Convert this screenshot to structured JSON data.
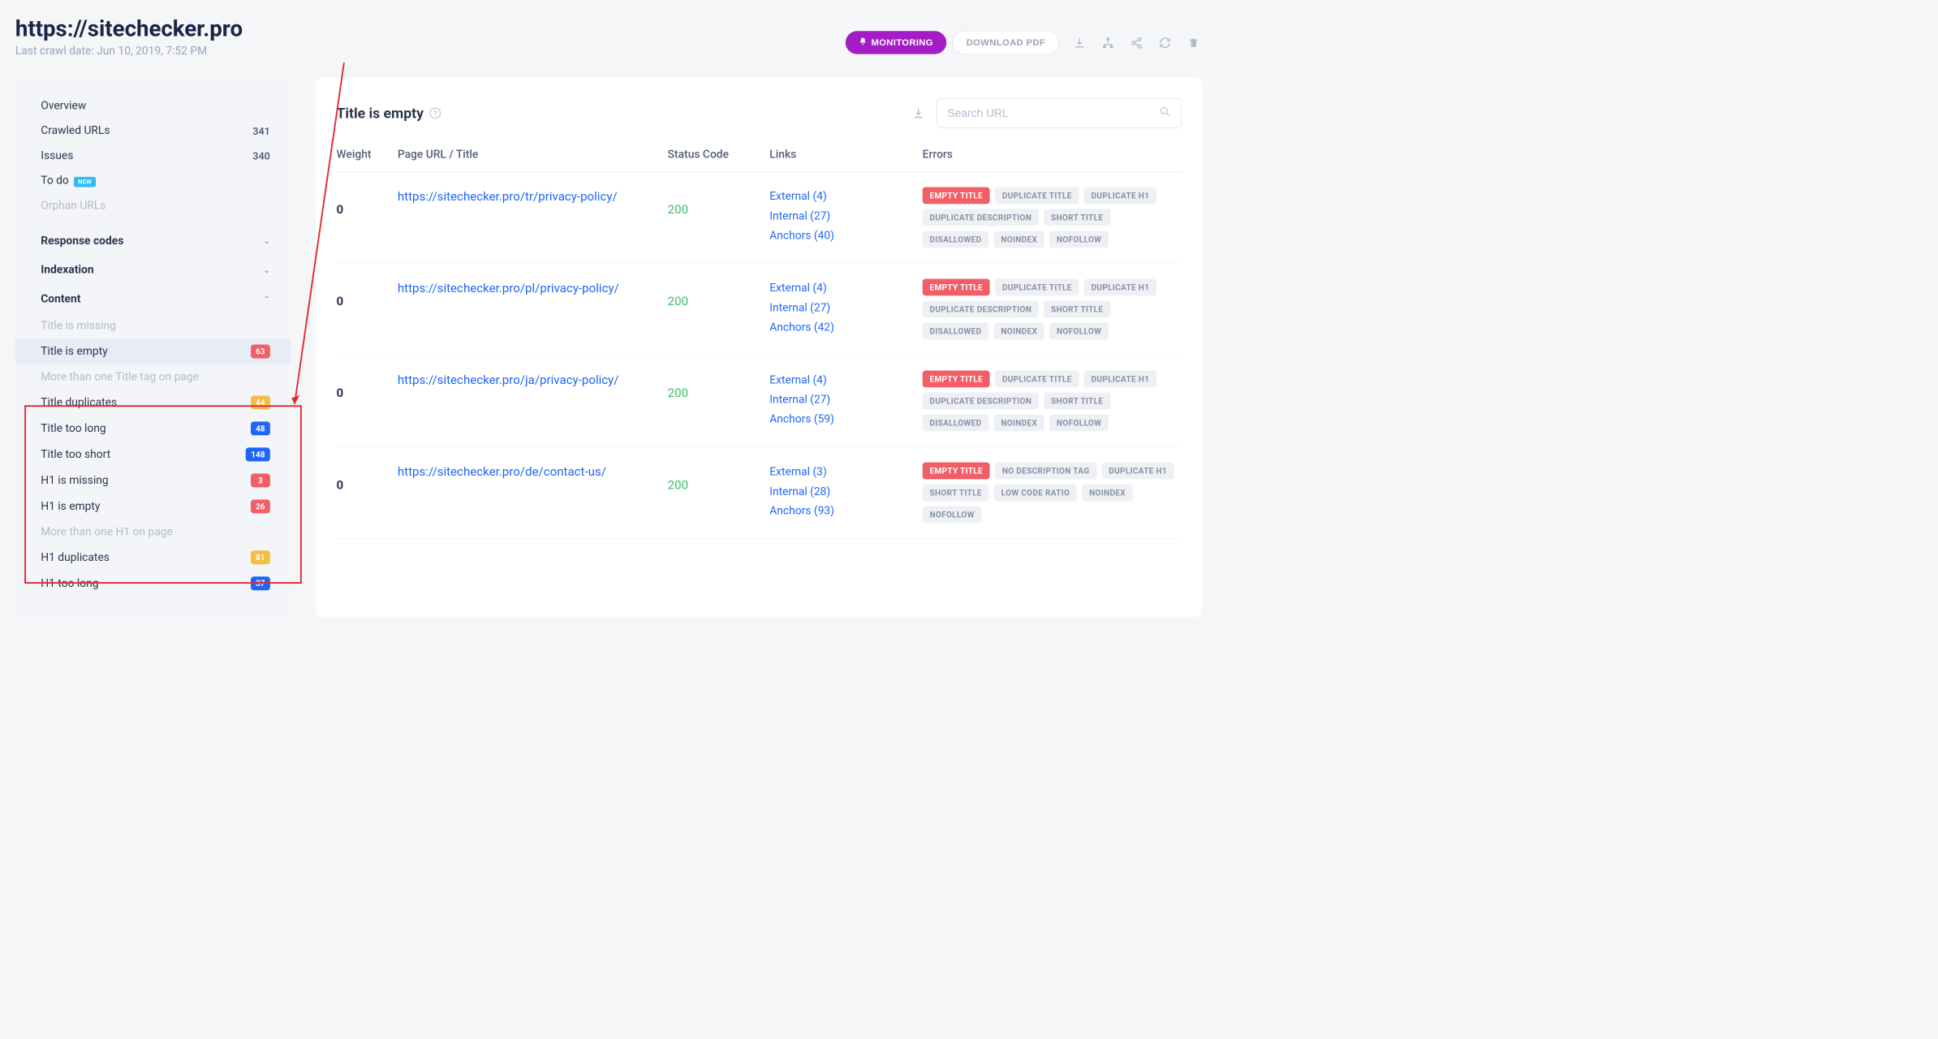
{
  "header": {
    "title": "https://sitechecker.pro",
    "crawl_date": "Last crawl date: Jun 10, 2019, 7:52 PM",
    "monitor_btn": "MONITORING",
    "pdf_btn": "DOWNLOAD PDF"
  },
  "sidebar": {
    "overview": "Overview",
    "crawled": "Crawled URLs",
    "crawled_n": "341",
    "issues": "Issues",
    "issues_n": "340",
    "todo": "To do",
    "new_tag": "NEW",
    "orphan": "Orphan URLs",
    "groups": {
      "response": "Response codes",
      "indexation": "Indexation",
      "content": "Content"
    },
    "content_items": [
      {
        "label": "Title is missing",
        "count": "",
        "color": "",
        "dim": true
      },
      {
        "label": "Title is empty",
        "count": "63",
        "color": "red",
        "active": true
      },
      {
        "label": "More than one Title tag on page",
        "count": "",
        "color": "",
        "dim": true
      },
      {
        "label": "Title duplicates",
        "count": "44",
        "color": "yellow"
      },
      {
        "label": "Title too long",
        "count": "48",
        "color": "blue"
      },
      {
        "label": "Title too short",
        "count": "148",
        "color": "blue"
      },
      {
        "label": "H1 is missing",
        "count": "3",
        "color": "red"
      },
      {
        "label": "H1 is empty",
        "count": "26",
        "color": "red"
      },
      {
        "label": "More than one H1 on page",
        "count": "",
        "color": "",
        "dim": true
      },
      {
        "label": "H1 duplicates",
        "count": "81",
        "color": "yellow"
      },
      {
        "label": "H1 too long",
        "count": "37",
        "color": "blue"
      }
    ]
  },
  "main": {
    "title": "Title is empty",
    "search_placeholder": "Search URL",
    "columns": {
      "weight": "Weight",
      "url": "Page URL / Title",
      "status": "Status Code",
      "links": "Links",
      "errors": "Errors"
    },
    "rows": [
      {
        "weight": "0",
        "url": "https://sitechecker.pro/tr/privacy-policy/",
        "status": "200",
        "links": [
          "External (4)",
          "Internal (27)",
          "Anchors (40)"
        ],
        "errors": [
          {
            "t": "EMPTY TITLE",
            "hot": true
          },
          {
            "t": "DUPLICATE TITLE"
          },
          {
            "t": "DUPLICATE H1"
          },
          {
            "t": "DUPLICATE DESCRIPTION"
          },
          {
            "t": "SHORT TITLE"
          },
          {
            "t": "DISALLOWED"
          },
          {
            "t": "NOINDEX"
          },
          {
            "t": "NOFOLLOW"
          }
        ]
      },
      {
        "weight": "0",
        "url": "https://sitechecker.pro/pl/privacy-policy/",
        "status": "200",
        "links": [
          "External (4)",
          "Internal (27)",
          "Anchors (42)"
        ],
        "errors": [
          {
            "t": "EMPTY TITLE",
            "hot": true
          },
          {
            "t": "DUPLICATE TITLE"
          },
          {
            "t": "DUPLICATE H1"
          },
          {
            "t": "DUPLICATE DESCRIPTION"
          },
          {
            "t": "SHORT TITLE"
          },
          {
            "t": "DISALLOWED"
          },
          {
            "t": "NOINDEX"
          },
          {
            "t": "NOFOLLOW"
          }
        ]
      },
      {
        "weight": "0",
        "url": "https://sitechecker.pro/ja/privacy-policy/",
        "status": "200",
        "links": [
          "External (4)",
          "Internal (27)",
          "Anchors (59)"
        ],
        "errors": [
          {
            "t": "EMPTY TITLE",
            "hot": true
          },
          {
            "t": "DUPLICATE TITLE"
          },
          {
            "t": "DUPLICATE H1"
          },
          {
            "t": "DUPLICATE DESCRIPTION"
          },
          {
            "t": "SHORT TITLE"
          },
          {
            "t": "DISALLOWED"
          },
          {
            "t": "NOINDEX"
          },
          {
            "t": "NOFOLLOW"
          }
        ]
      },
      {
        "weight": "0",
        "url": "https://sitechecker.pro/de/contact-us/",
        "status": "200",
        "links": [
          "External (3)",
          "Internal (28)",
          "Anchors (93)"
        ],
        "errors": [
          {
            "t": "EMPTY TITLE",
            "hot": true
          },
          {
            "t": "NO DESCRIPTION TAG"
          },
          {
            "t": "DUPLICATE H1"
          },
          {
            "t": "SHORT TITLE"
          },
          {
            "t": "LOW CODE RATIO"
          },
          {
            "t": "NOINDEX"
          },
          {
            "t": "NOFOLLOW"
          }
        ]
      }
    ]
  }
}
